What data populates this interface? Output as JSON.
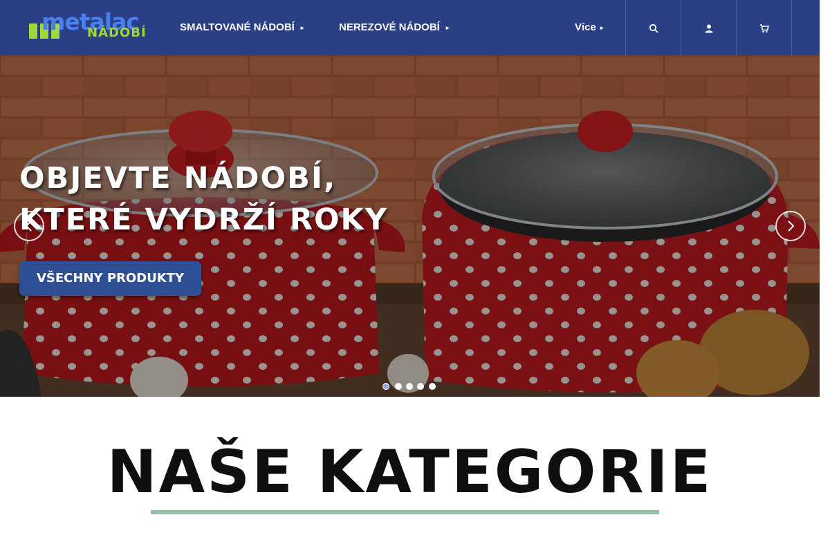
{
  "header": {
    "logo_word": "metalac",
    "logo_sub": "NÁDOBÍ",
    "nav": [
      {
        "label": "SMALTOVANÉ NÁDOBÍ",
        "chevron": "▸"
      },
      {
        "label": "NEREZOVÉ NÁDOBÍ",
        "chevron": "▸"
      }
    ],
    "more": {
      "label": "Více",
      "chevron": "▸"
    },
    "icons": [
      "search-icon",
      "user-icon",
      "cart-icon"
    ],
    "background_color": "#2b3f87"
  },
  "hero": {
    "title_line1": "OBJEVTE NÁDOBÍ,",
    "title_line2": "KTERÉ VYDRŽÍ ROKY",
    "button_label": "VŠECHNY PRODUKTY",
    "button_color": "#2f4f95",
    "slides_count": 5,
    "active_slide": 1
  },
  "categories": {
    "title": "NAŠE KATEGORIE",
    "underline_color": "#93c1a4"
  }
}
